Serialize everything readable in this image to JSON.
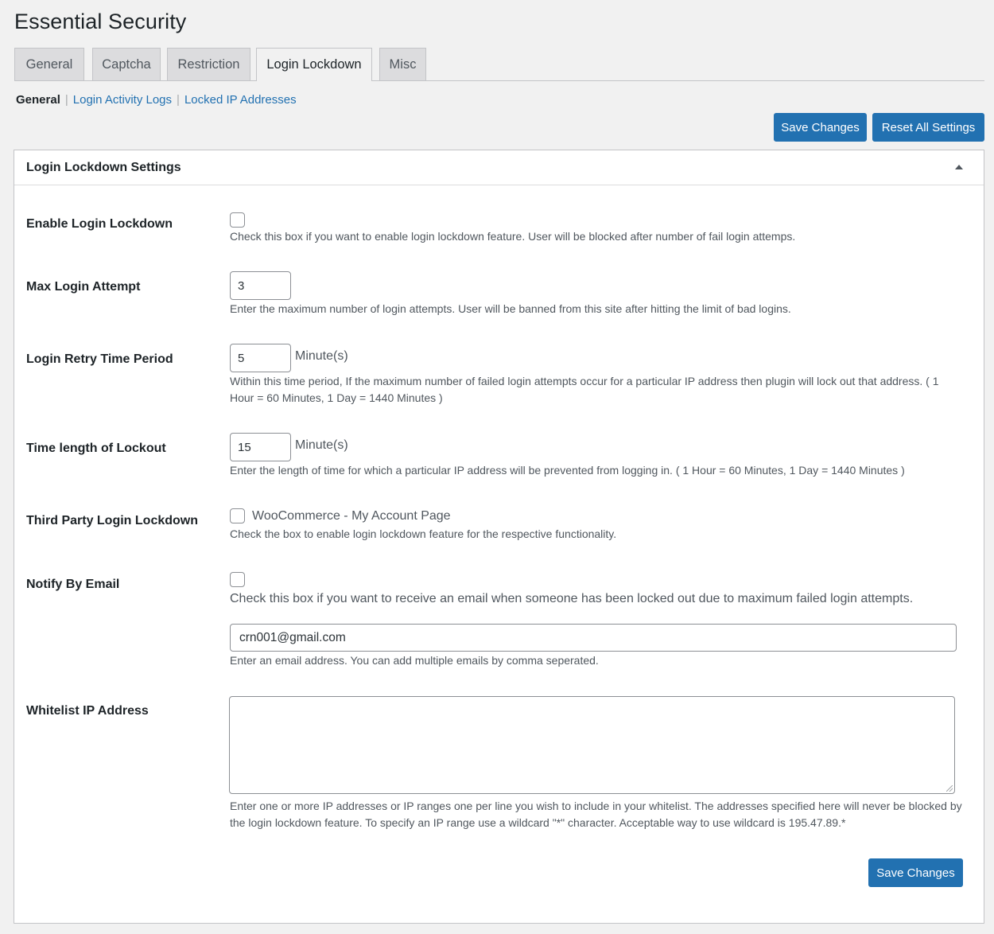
{
  "page": {
    "title": "Essential Security"
  },
  "tabs": [
    {
      "label": "General"
    },
    {
      "label": "Captcha"
    },
    {
      "label": "Restriction"
    },
    {
      "label": "Login Lockdown"
    },
    {
      "label": "Misc"
    }
  ],
  "active_tab": "Login Lockdown",
  "subnav": {
    "current": "General",
    "links": [
      "Login Activity Logs",
      "Locked IP Addresses"
    ]
  },
  "actions": {
    "save_label": "Save Changes",
    "reset_label": "Reset All Settings",
    "bottom_save_label": "Save Changes"
  },
  "panel": {
    "title": "Login Lockdown Settings",
    "collapse_icon": "triangle-up-icon"
  },
  "settings": {
    "enable_lockdown": {
      "label": "Enable Login Lockdown",
      "checked": false,
      "description": "Check this box if you want to enable login lockdown feature. User will be blocked after number of fail login attemps."
    },
    "max_attempt": {
      "label": "Max Login Attempt",
      "value": "3",
      "description": "Enter the maximum number of login attempts. User will be banned from this site after hitting the limit of bad logins."
    },
    "retry_period": {
      "label": "Login Retry Time Period",
      "value": "5",
      "unit": "Minute(s)",
      "description": "Within this time period, If the maximum number of failed login attempts occur for a particular IP address then plugin will lock out that address. ( 1 Hour = 60 Minutes, 1 Day = 1440 Minutes )"
    },
    "lockout_length": {
      "label": "Time length of Lockout",
      "value": "15",
      "unit": "Minute(s)",
      "description": "Enter the length of time for which a particular IP address will be prevented from logging in. ( 1 Hour = 60 Minutes, 1 Day = 1440 Minutes )"
    },
    "third_party": {
      "label": "Third Party Login Lockdown",
      "option_label": "WooCommerce - My Account Page",
      "checked": false,
      "description": "Check the box to enable login lockdown feature for the respective functionality."
    },
    "notify_email": {
      "label": "Notify By Email",
      "checked": false,
      "description": "Check this box if you want to receive an email when someone has been locked out due to maximum failed login attempts.",
      "email_value": "crn001@gmail.com",
      "email_description": "Enter an email address. You can add multiple emails by comma seperated."
    },
    "whitelist": {
      "label": "Whitelist IP Address",
      "value": "",
      "description": "Enter one or more IP addresses or IP ranges one per line you wish to include in your whitelist. The addresses specified here will never be blocked by the login lockdown feature. To specify an IP range use a wildcard \"*\" character. Acceptable way to use wildcard is 195.47.89.*"
    }
  }
}
